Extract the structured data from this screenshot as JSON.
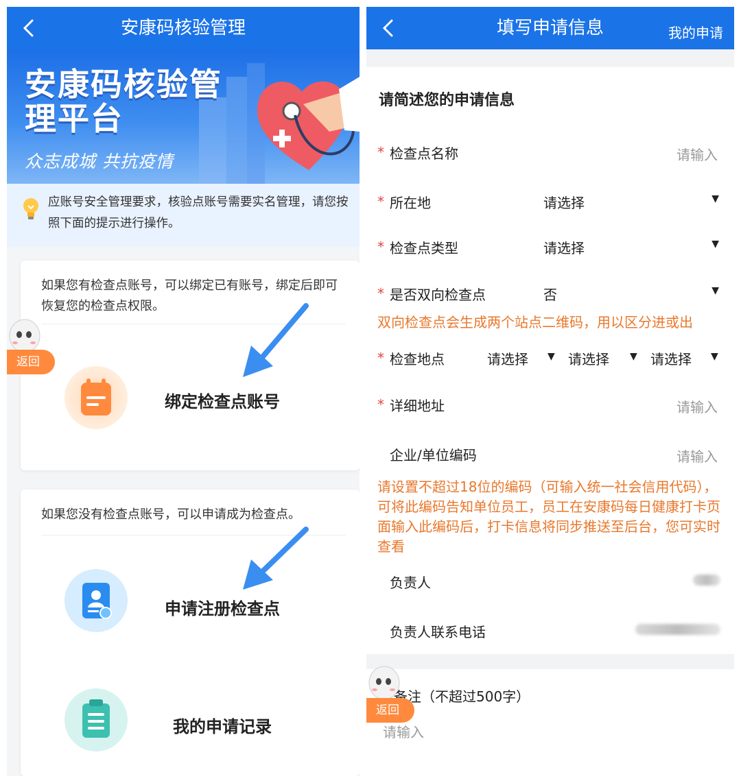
{
  "left": {
    "nav": {
      "title": "安康码核验管理"
    },
    "banner": {
      "title": "安康码核验管理平台",
      "slogan": "众志成城 共抗疫情"
    },
    "notice": {
      "text": "应账号安全管理要求，核验点账号需要实名管理，请您按照下面的提示进行操作。"
    },
    "card1": {
      "tip": "如果您有检查点账号，可以绑定已有账号，绑定后即可恢复您的检查点权限。",
      "action": "绑定检查点账号"
    },
    "card2": {
      "tip": "如果您没有检查点账号，可以申请成为检查点。",
      "action1": "申请注册检查点",
      "action2": "我的申请记录"
    },
    "float": {
      "return_label": "返回"
    }
  },
  "right": {
    "nav": {
      "title": "填写申请信息",
      "link": "我的申请"
    },
    "section_title": "请简述您的申请信息",
    "fields": {
      "name": {
        "label": "检查点名称",
        "placeholder": "请输入"
      },
      "location": {
        "label": "所在地",
        "value": "请选择"
      },
      "type": {
        "label": "检查点类型",
        "value": "请选择"
      },
      "bidirectional": {
        "label": "是否双向检查点",
        "value": "否"
      },
      "site": {
        "label": "检查地点",
        "values": [
          "请选择",
          "请选择",
          "请选择"
        ]
      },
      "address": {
        "label": "详细地址",
        "placeholder": "请输入"
      },
      "org_code": {
        "label": "企业/单位编码",
        "placeholder": "请输入"
      },
      "manager": {
        "label": "负责人"
      },
      "phone": {
        "label": "负责人联系电话"
      },
      "remark": {
        "label": "备注（不超过500字）",
        "placeholder": "请输入"
      }
    },
    "warnings": {
      "bidirectional": "双向检查点会生成两个站点二维码，用以区分进或出",
      "org_code": "请设置不超过18位的编码（可输入统一社会信用代码），可将此编码告知单位员工，员工在安康码每日健康打卡页面输入此编码后，打卡信息将同步推送至后台，您可实时查看"
    },
    "float": {
      "return_label": "返回"
    }
  },
  "colors": {
    "primary": "#1b73e8",
    "warning": "#e8782c",
    "required": "#e54545",
    "float_button": "#ff8a3d"
  },
  "icons": [
    "chevron-left-icon",
    "lightbulb-icon",
    "notepad-icon",
    "id-card-icon",
    "clipboard-list-icon",
    "robot-mascot-icon",
    "triangle-down-icon"
  ]
}
